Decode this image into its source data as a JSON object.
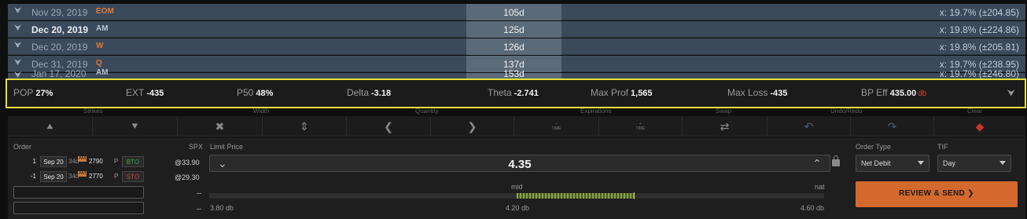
{
  "expirations": [
    {
      "date": "Nov 29, 2019",
      "tag": "EOM",
      "dte": "105d",
      "iv": "x: 19.7% (±204.85)",
      "bold": false
    },
    {
      "date": "Dec 20, 2019",
      "tag": "AM",
      "dte": "125d",
      "iv": "x: 19.8% (±224.86)",
      "bold": true
    },
    {
      "date": "Dec 20, 2019",
      "tag": "W",
      "dte": "126d",
      "iv": "x: 19.8% (±205.81)",
      "bold": false
    },
    {
      "date": "Dec 31, 2019",
      "tag": "Q",
      "dte": "137d",
      "iv": "x: 19.7% (±238.95)",
      "bold": false
    }
  ],
  "partial_row": {
    "date": "Jan 17, 2020",
    "tag": "AM",
    "dte": "153d",
    "iv": "x: 19.7% (±246.80)"
  },
  "stats": {
    "pop_label": "POP",
    "pop_value": "27%",
    "ext_label": "EXT",
    "ext_value": "-435",
    "p50_label": "P50",
    "p50_value": "48%",
    "delta_label": "Delta",
    "delta_value": "-3.18",
    "theta_label": "Theta",
    "theta_value": "-2.741",
    "maxprof_label": "Max Prof",
    "maxprof_value": "1,565",
    "maxloss_label": "Max Loss",
    "maxloss_value": "-435",
    "bpeff_label": "BP Eff",
    "bpeff_value": "435.00",
    "bpeff_unit": "db"
  },
  "groups": {
    "strikes": "Strikes",
    "width": "Width",
    "quantity": "Quantity",
    "expirations": "Expirations",
    "swap": "Swap",
    "undo_redo": "Undo/Redo",
    "clear": "Clear"
  },
  "toolbar": {
    "time_label": "TIME"
  },
  "order": {
    "order_label": "Order",
    "spx_label": "SPX",
    "limit_label": "Limit Price",
    "legs": [
      {
        "qty": "1",
        "exp": "Sep 20",
        "dte": "34d",
        "am": "AM",
        "strike": "2790",
        "type": "P",
        "action": "BTO",
        "spx": "@33.90"
      },
      {
        "qty": "-1",
        "exp": "Sep 20",
        "dte": "34d",
        "am": "AM",
        "strike": "2770",
        "type": "P",
        "action": "STO",
        "spx": "@29.30"
      }
    ],
    "dash1": "--",
    "dash2": "--",
    "limit_price": "4.35",
    "mid_label": "mid",
    "nat_label": "nat",
    "low_label": "3.80 db",
    "mid_value": "4.20 db",
    "high_label": "4.60 db",
    "slider_fill_start": 0.5,
    "slider_fill_end": 0.69,
    "order_type_label": "Order Type",
    "order_type_value": "Net Debit",
    "tif_label": "TIF",
    "tif_value": "Day",
    "review_label": "REVIEW & SEND ❯"
  }
}
